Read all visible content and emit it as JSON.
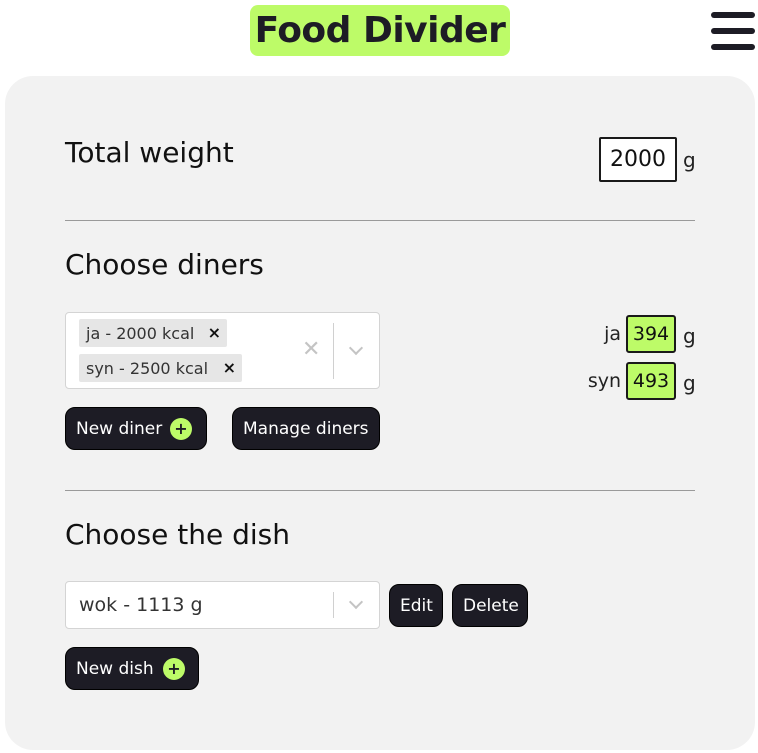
{
  "header": {
    "app_title": "Food Divider",
    "menu_icon": "hamburger-menu-icon"
  },
  "weight": {
    "title": "Total weight",
    "value": "2000",
    "unit": "g"
  },
  "diners": {
    "title": "Choose diners",
    "selected": [
      {
        "label": "ja - 2000 kcal",
        "remove": "×"
      },
      {
        "label": "syn - 2500 kcal",
        "remove": "×"
      }
    ],
    "clear": "✕",
    "portions": [
      {
        "name": "ja",
        "value": "394",
        "unit": "g"
      },
      {
        "name": "syn",
        "value": "493",
        "unit": "g"
      }
    ],
    "new_diner_label": "New diner",
    "manage_diners_label": "Manage diners",
    "plus": "+"
  },
  "dish": {
    "title": "Choose the dish",
    "selected": "wok - 1113 g",
    "edit_label": "Edit",
    "delete_label": "Delete",
    "new_dish_label": "New dish",
    "plus": "+"
  },
  "colors": {
    "accent": "#bdfb68",
    "dark": "#1d1c25",
    "panel": "#f2f2f2"
  }
}
